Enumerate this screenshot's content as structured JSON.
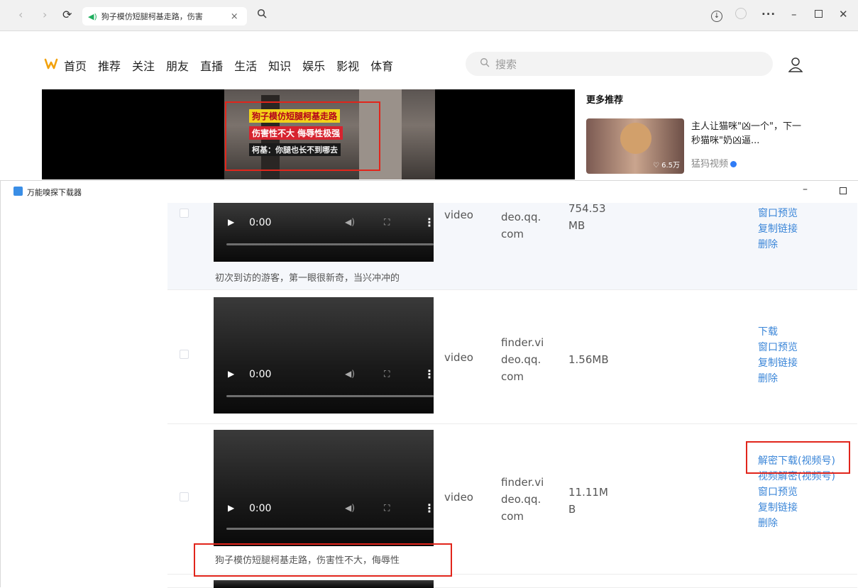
{
  "browser": {
    "tab_title": "狗子模仿短腿柯基走路，伤害",
    "tab_close": "×"
  },
  "site": {
    "nav": [
      "首页",
      "推荐",
      "关注",
      "朋友",
      "直播",
      "生活",
      "知识",
      "娱乐",
      "影视",
      "体育"
    ],
    "search_placeholder": "搜索"
  },
  "player": {
    "caption_line1": "狗子模仿短腿柯基走路",
    "caption_line2": "伤害性不大 侮辱性极强",
    "caption_line3": "柯基：你腿也长不到哪去"
  },
  "recommend": {
    "heading": "更多推荐",
    "title": "主人让猫咪\"凶一个\"，下一秒猫咪\"奶凶逼...",
    "views": "6.5万",
    "author": "猛犸视频"
  },
  "downloader": {
    "app_title": "万能嗅探下载器",
    "rows": [
      {
        "time": "0:00",
        "type": "video",
        "domain": "deo.qq.\ncom",
        "size_line1": "754.53",
        "size_line2": "MB",
        "actions": [
          "窗口预览",
          "复制链接",
          "删除"
        ],
        "description": "初次到访的游客，第一眼很新奇，当兴冲冲的"
      },
      {
        "time": "0:00",
        "type": "video",
        "domain_lines": [
          "finder.vi",
          "deo.qq.",
          "com"
        ],
        "size": "1.56MB",
        "actions": [
          "下载",
          "窗口预览",
          "复制链接",
          "删除"
        ]
      },
      {
        "time": "0:00",
        "type": "video",
        "domain_lines": [
          "finder.vi",
          "deo.qq.",
          "com"
        ],
        "size_lines": [
          "11.11M",
          "B"
        ],
        "actions": [
          "解密下载(视频号)",
          "视频解密(视频号)",
          "窗口预览",
          "复制链接",
          "删除"
        ],
        "description": "狗子模仿短腿柯基走路，伤害性不大，侮辱性"
      }
    ]
  }
}
